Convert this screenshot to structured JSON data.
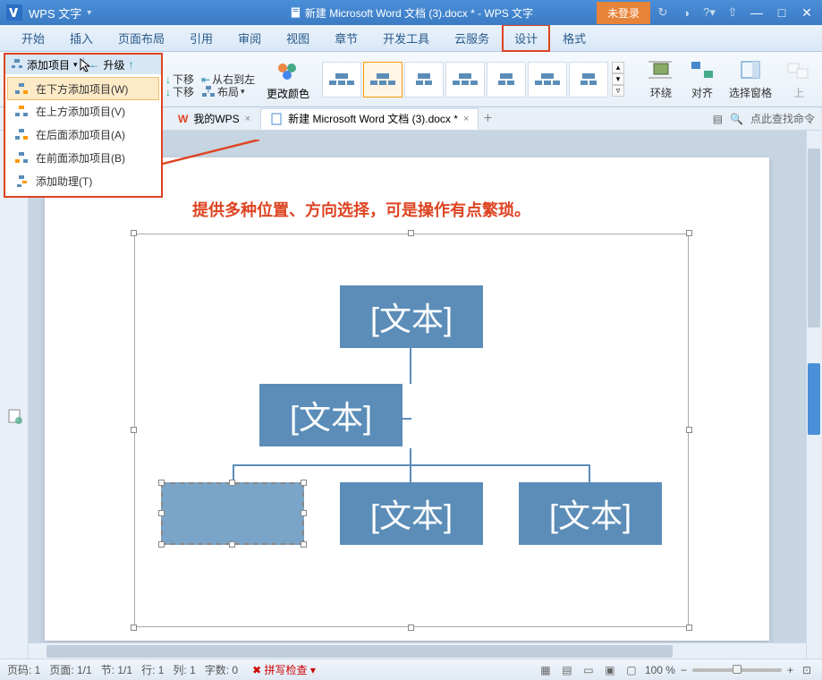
{
  "titlebar": {
    "app_name": "WPS 文字",
    "doc_title": "新建 Microsoft Word 文档 (3).docx * - WPS 文字",
    "login": "未登录"
  },
  "tabs": {
    "items": [
      "开始",
      "插入",
      "页面布局",
      "引用",
      "审阅",
      "视图",
      "章节",
      "开发工具",
      "云服务",
      "设计",
      "格式"
    ],
    "active": "设计",
    "highlighted": "设计"
  },
  "ribbon": {
    "add_item": "添加项目",
    "promote": "升级",
    "move_down": "下移",
    "rtl": "从右到左",
    "layout": "布局",
    "change_color": "更改颜色",
    "wrap": "环绕",
    "align": "对齐",
    "selection_pane": "选择窗格"
  },
  "dropdown": {
    "items": [
      "在下方添加项目(W)",
      "在上方添加项目(V)",
      "在后面添加项目(A)",
      "在前面添加项目(B)",
      "添加助理(T)"
    ]
  },
  "doc_tabs": {
    "mywps": "我的WPS",
    "doc": "新建 Microsoft Word 文档 (3).docx *",
    "search": "点此查找命令"
  },
  "annotation": "提供多种位置、方向选择，可是操作有点繁琐。",
  "smartart": {
    "node_text": "[文本]"
  },
  "statusbar": {
    "page_code": "页码: 1",
    "page": "页面: 1/1",
    "section": "节: 1/1",
    "line": "行: 1",
    "col": "列: 1",
    "chars": "字数: 0",
    "spell": "拼写检查",
    "zoom": "100 %"
  }
}
